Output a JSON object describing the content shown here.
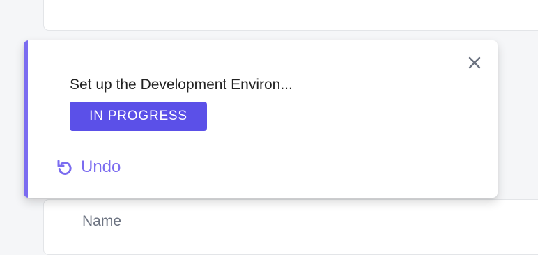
{
  "task": {
    "title": "Set up the Development Environ...",
    "status": "IN PROGRESS"
  },
  "toast": {
    "undo_label": "Undo",
    "close_icon": "close-icon",
    "undo_icon": "undo-icon"
  },
  "table": {
    "column_name": "Name"
  },
  "colors": {
    "accent": "#7b6cf0",
    "badge": "#5b50e8",
    "background": "#f5f6f8"
  }
}
